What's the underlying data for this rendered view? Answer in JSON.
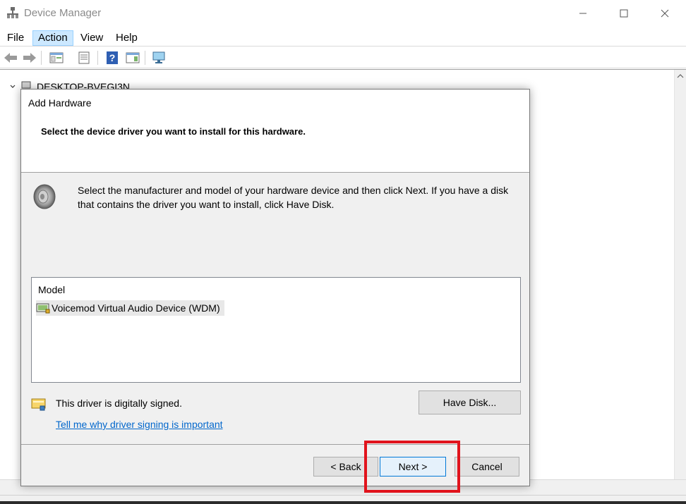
{
  "window": {
    "title": "Device Manager",
    "menu": [
      "File",
      "Action",
      "View",
      "Help"
    ],
    "active_menu": "Action",
    "tree_root": "DESKTOP-BVEGI3N"
  },
  "dialog": {
    "title": "Add Hardware",
    "subtitle": "Select the device driver you want to install for this hardware.",
    "instructions": "Select the manufacturer and model of your hardware device and then click Next. If you have a disk that contains the driver you want to install, click Have Disk.",
    "model_list": {
      "header": "Model",
      "items": [
        "Voicemod Virtual Audio Device (WDM)"
      ]
    },
    "signed_text": "This driver is digitally signed.",
    "signing_link": "Tell me why driver signing is important",
    "buttons": {
      "have_disk": "Have Disk...",
      "back": "< Back",
      "next": "Next >",
      "cancel": "Cancel"
    }
  },
  "colors": {
    "highlight": "#e1131c",
    "link": "#0066cc",
    "accent": "#0078d7"
  }
}
